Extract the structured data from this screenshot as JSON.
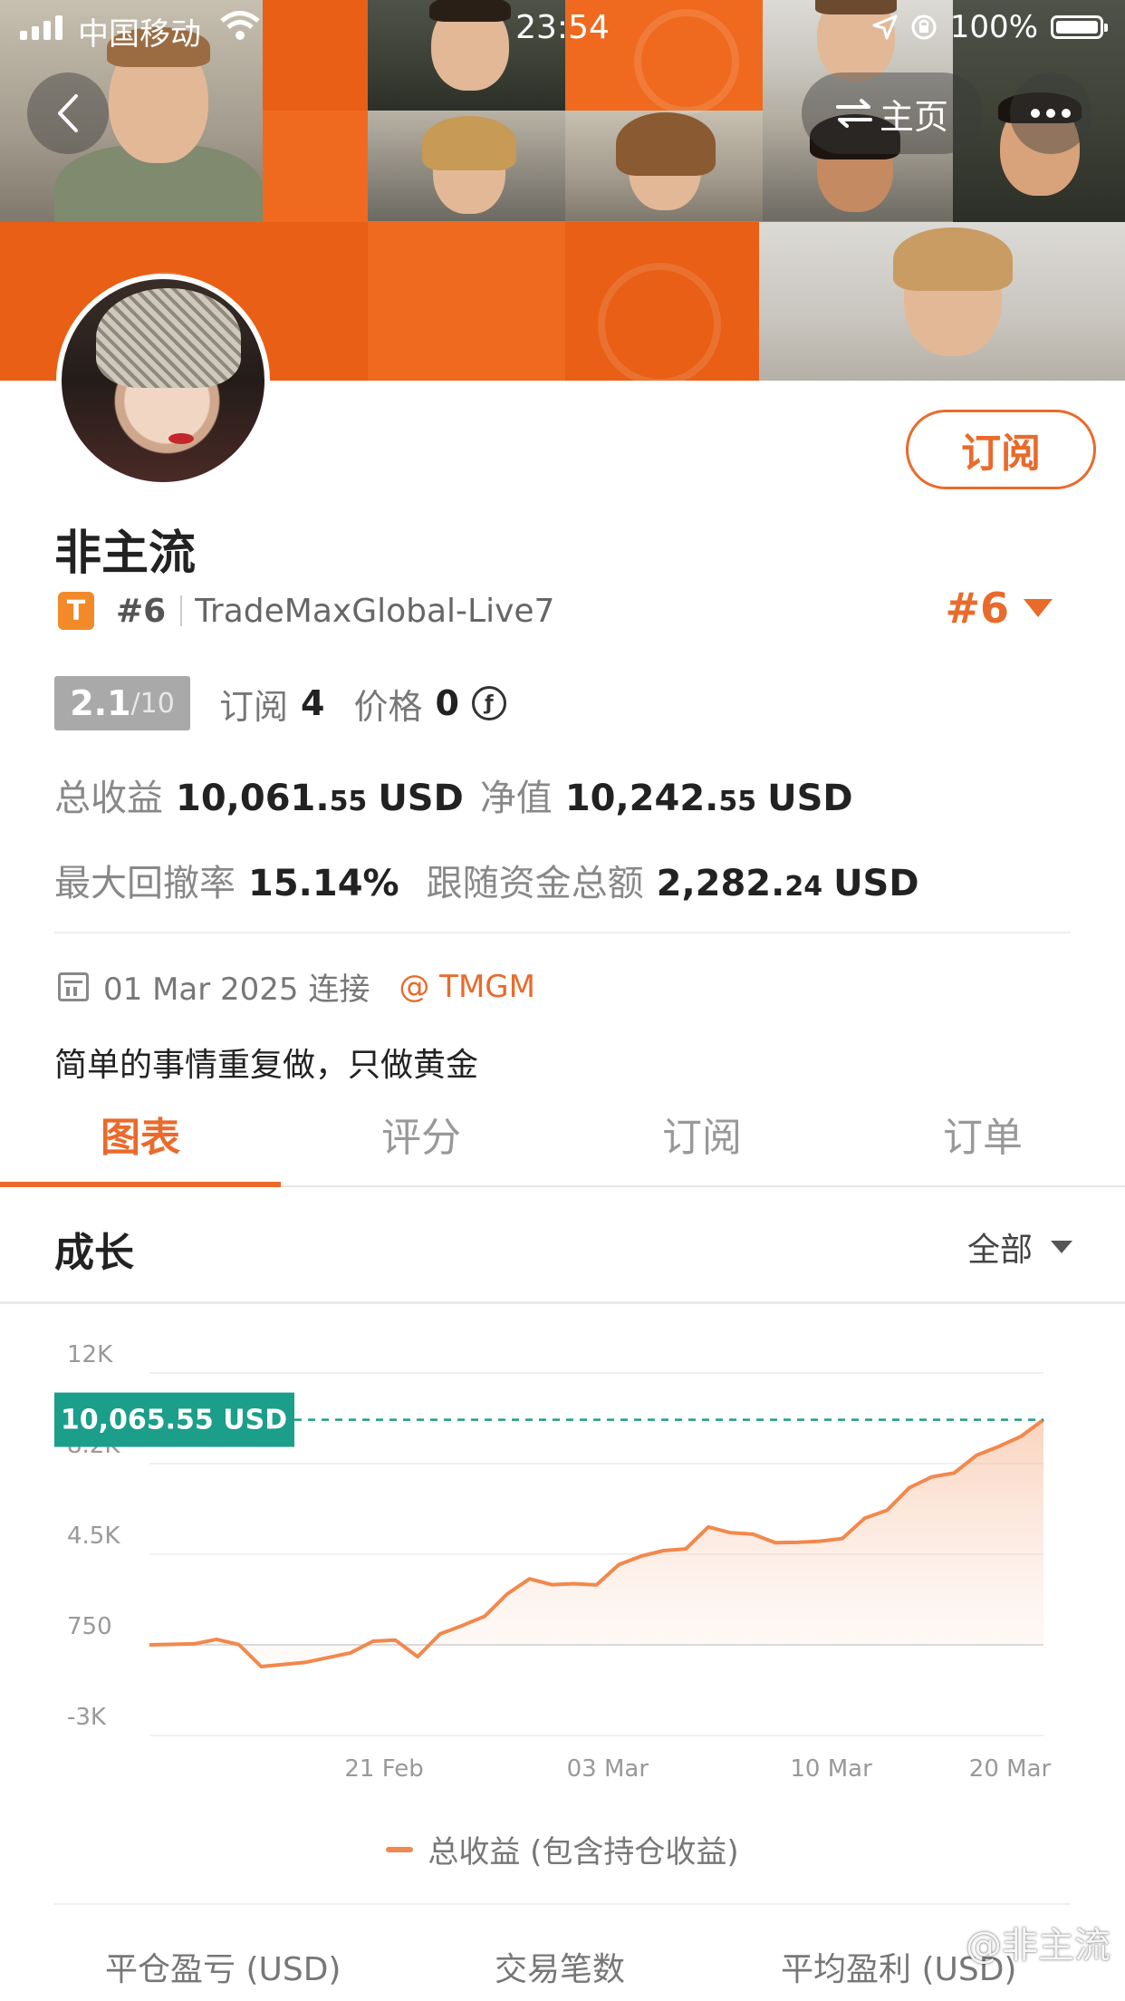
{
  "status_bar": {
    "carrier": "中国移动",
    "time": "23:54",
    "battery": "100%"
  },
  "nav": {
    "home_label": "主页"
  },
  "profile": {
    "name": "非主流",
    "badge": "T",
    "rank_small": "#6",
    "account": "TradeMaxGlobal-Live7",
    "rank_big": "#6",
    "subscribe_label": "订阅",
    "score": "2.1",
    "score_max": "/10",
    "subs_label": "订阅",
    "subs_value": "4",
    "price_label": "价格",
    "price_value": "0"
  },
  "stats": {
    "total_profit_label": "总收益",
    "total_profit_int": "10,061.",
    "total_profit_dec": "55",
    "total_profit_unit": "USD",
    "net_value_label": "净值",
    "net_value_int": "10,242.",
    "net_value_dec": "55",
    "net_value_unit": "USD",
    "max_drawdown_label": "最大回撤率",
    "max_drawdown_value": "15.14%",
    "follow_funds_label": "跟随资金总额",
    "follow_funds_int": "2,282.",
    "follow_funds_dec": "24",
    "follow_funds_unit": "USD"
  },
  "info": {
    "connect_date": "01 Mar 2025 连接",
    "broker": "@ TMGM",
    "bio": "简单的事情重复做，只做黄金"
  },
  "tabs": [
    "图表",
    "评分",
    "订阅",
    "订单"
  ],
  "growth": {
    "title": "成长",
    "range": "全部"
  },
  "legend_label": "总收益 (包含持仓收益)",
  "bottom_labels": [
    "平仓盈亏 (USD)",
    "交易笔数",
    "平均盈利 (USD)"
  ],
  "watermark": "@非主流",
  "colors": {
    "accent": "#ea6a2b",
    "line": "#f2884d",
    "marker": "#1b9e8a"
  },
  "chart_data": {
    "type": "area",
    "yticks": [
      "12K",
      "8.2K",
      "4.5K",
      "750",
      "-3K"
    ],
    "ytick_values": [
      12000,
      8250,
      4500,
      750,
      -3000
    ],
    "ylim": [
      -3000,
      12000
    ],
    "xticks": [
      "21 Feb",
      "03 Mar",
      "10 Mar",
      "20 Mar"
    ],
    "xtick_positions": [
      10.5,
      20.5,
      30.5,
      38.5
    ],
    "xlim": [
      0,
      40
    ],
    "current_label": "10,065.55 USD",
    "current_value": 10065.55,
    "series": [
      {
        "name": "总收益 (包含持仓收益)",
        "x": [
          0,
          2,
          3,
          4,
          5,
          6,
          7,
          8,
          9,
          10,
          11,
          12,
          13,
          14,
          15,
          16,
          17,
          18,
          19,
          20,
          21,
          22,
          23,
          24,
          25,
          26,
          27,
          28,
          29,
          30,
          31,
          32,
          33,
          34,
          35,
          36,
          37,
          38,
          39,
          40
        ],
        "y": [
          750,
          790,
          980,
          760,
          -150,
          -60,
          30,
          220,
          420,
          900,
          950,
          260,
          1200,
          1550,
          1930,
          2850,
          3480,
          3240,
          3280,
          3230,
          4070,
          4420,
          4650,
          4720,
          5630,
          5390,
          5330,
          4980,
          4990,
          5040,
          5150,
          5990,
          6320,
          7250,
          7700,
          7860,
          8590,
          8960,
          9380,
          10065
        ]
      }
    ],
    "grid": true
  }
}
